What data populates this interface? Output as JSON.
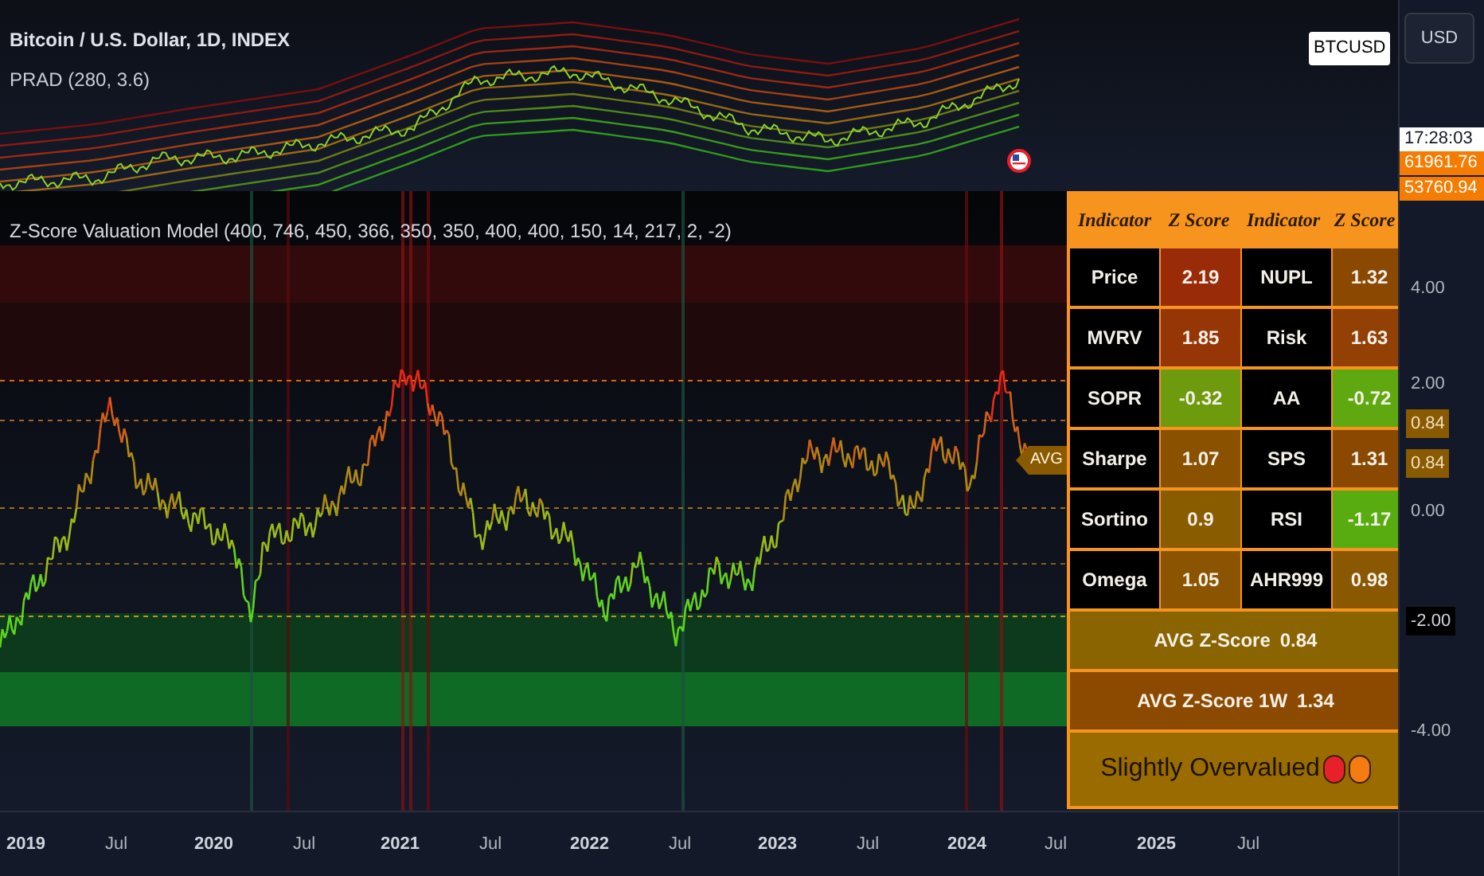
{
  "top_pane": {
    "symbol_title": "Bitcoin / U.S. Dollar, 1D, INDEX",
    "indicator_label": "PRAD (280, 3.6)",
    "symbol_badge": "BTCUSD",
    "currency_button": "USD",
    "price_labels": [
      {
        "text": "17:28:03",
        "kind": "countdown"
      },
      {
        "text": "61961.76",
        "kind": "price"
      },
      {
        "text": "53760.94",
        "kind": "price"
      }
    ]
  },
  "lower_pane": {
    "indicator_label": "Z-Score Valuation Model (400, 746, 450, 366, 350, 350, 400, 400, 150, 14, 217, 2, -2)",
    "avg_tag": "AVG",
    "scale_labels": [
      {
        "text": "4.00",
        "kind": "plain"
      },
      {
        "text": "2.00",
        "kind": "plain"
      },
      {
        "text": "0.84",
        "kind": "tag"
      },
      {
        "text": "0.84",
        "kind": "tag"
      },
      {
        "text": "0.00",
        "kind": "plain"
      },
      {
        "text": "-2.00",
        "kind": "boxed"
      },
      {
        "text": "-4.00",
        "kind": "plain"
      }
    ]
  },
  "table": {
    "headers": [
      "Indicator",
      "Z Score",
      "Indicator",
      "Z Score"
    ],
    "rows": [
      [
        {
          "text": "Price",
          "kind": "name"
        },
        {
          "text": "2.19",
          "kind": "score",
          "color": "#9a2b08"
        },
        {
          "text": "NUPL",
          "kind": "name"
        },
        {
          "text": "1.32",
          "kind": "score",
          "color": "#8a4800"
        }
      ],
      [
        {
          "text": "MVRV",
          "kind": "name"
        },
        {
          "text": "1.85",
          "kind": "score",
          "color": "#963606"
        },
        {
          "text": "Risk",
          "kind": "name"
        },
        {
          "text": "1.63",
          "kind": "score",
          "color": "#924004"
        }
      ],
      [
        {
          "text": "SOPR",
          "kind": "name"
        },
        {
          "text": "-0.32",
          "kind": "score",
          "color": "#6e9a0e"
        },
        {
          "text": "AA",
          "kind": "name"
        },
        {
          "text": "-0.72",
          "kind": "score",
          "color": "#60a810"
        }
      ],
      [
        {
          "text": "Sharpe",
          "kind": "name"
        },
        {
          "text": "1.07",
          "kind": "score",
          "color": "#8a5200"
        },
        {
          "text": "SPS",
          "kind": "name"
        },
        {
          "text": "1.31",
          "kind": "score",
          "color": "#8a4800"
        }
      ],
      [
        {
          "text": "Sortino",
          "kind": "name"
        },
        {
          "text": "0.9",
          "kind": "score",
          "color": "#8a5c00"
        },
        {
          "text": "RSI",
          "kind": "name"
        },
        {
          "text": "-1.17",
          "kind": "score",
          "color": "#58ac10"
        }
      ],
      [
        {
          "text": "Omega",
          "kind": "name"
        },
        {
          "text": "1.05",
          "kind": "score",
          "color": "#8a5400"
        },
        {
          "text": "AHR999",
          "kind": "name"
        },
        {
          "text": "0.98",
          "kind": "score",
          "color": "#8a5800"
        }
      ]
    ],
    "summary": [
      {
        "label": "AVG Z-Score",
        "value": "0.84",
        "color": "#8a6400"
      },
      {
        "label": "AVG Z-Score 1W",
        "value": "1.34",
        "color": "#8c4a00"
      }
    ],
    "status": {
      "text": "Slightly Overvalued",
      "color": "#9a6c00",
      "dots": [
        {
          "color": "#e8202a"
        },
        {
          "color": "#f57c10"
        }
      ]
    }
  },
  "time_axis": [
    {
      "text": "2019",
      "kind": "year"
    },
    {
      "text": "Jul",
      "kind": "month"
    },
    {
      "text": "2020",
      "kind": "year"
    },
    {
      "text": "Jul",
      "kind": "month"
    },
    {
      "text": "2021",
      "kind": "year"
    },
    {
      "text": "Jul",
      "kind": "month"
    },
    {
      "text": "2022",
      "kind": "year"
    },
    {
      "text": "Jul",
      "kind": "month"
    },
    {
      "text": "2023",
      "kind": "year"
    },
    {
      "text": "Jul",
      "kind": "month"
    },
    {
      "text": "2024",
      "kind": "year"
    },
    {
      "text": "Jul",
      "kind": "month"
    },
    {
      "text": "2025",
      "kind": "year"
    },
    {
      "text": "Jul",
      "kind": "month"
    }
  ]
}
